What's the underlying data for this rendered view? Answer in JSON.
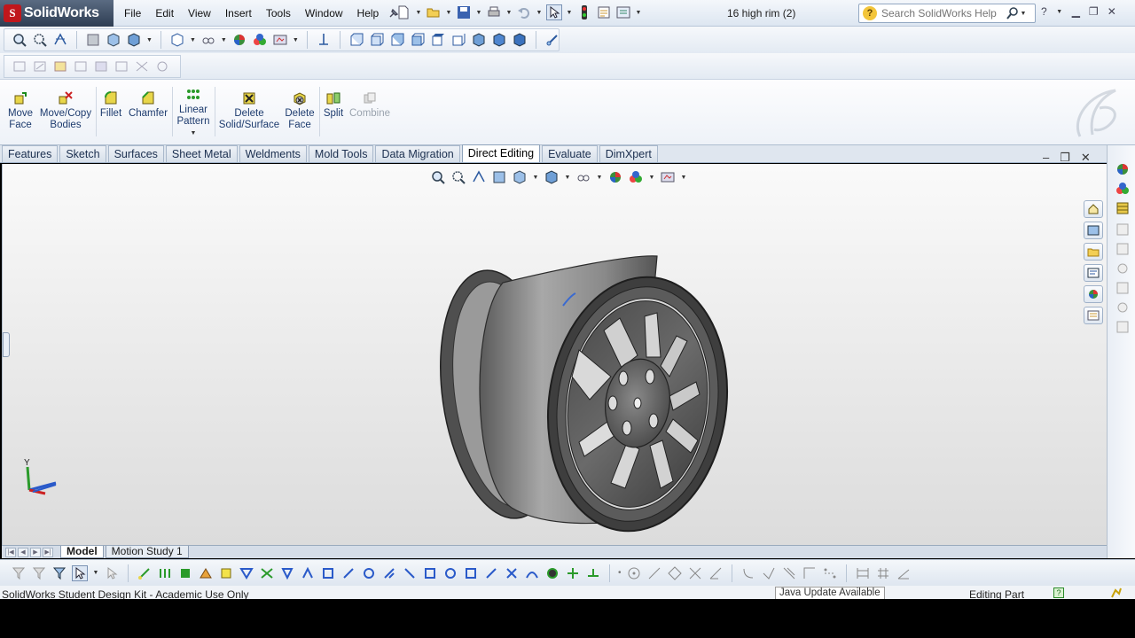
{
  "app": {
    "logo_text": "SolidWorks",
    "menus": [
      "File",
      "Edit",
      "View",
      "Insert",
      "Tools",
      "Window",
      "Help"
    ],
    "document_title": "16 high rim (2)"
  },
  "search": {
    "placeholder": "Search SolidWorks Help"
  },
  "command_manager": {
    "commands": [
      {
        "label": "Move\nFace",
        "icon": "move-face-icon"
      },
      {
        "label": "Move/Copy\nBodies",
        "icon": "move-copy-bodies-icon"
      },
      {
        "label": "Fillet",
        "icon": "fillet-icon"
      },
      {
        "label": "Chamfer",
        "icon": "chamfer-icon"
      },
      {
        "label": "Linear\nPattern",
        "icon": "linear-pattern-icon"
      },
      {
        "label": "Delete\nSolid/Surface",
        "icon": "delete-solid-icon"
      },
      {
        "label": "Delete\nFace",
        "icon": "delete-face-icon"
      },
      {
        "label": "Split",
        "icon": "split-icon"
      },
      {
        "label": "Combine",
        "icon": "combine-icon"
      }
    ]
  },
  "tabs": [
    {
      "label": "Features",
      "active": false
    },
    {
      "label": "Sketch",
      "active": false
    },
    {
      "label": "Surfaces",
      "active": false
    },
    {
      "label": "Sheet Metal",
      "active": false
    },
    {
      "label": "Weldments",
      "active": false
    },
    {
      "label": "Mold Tools",
      "active": false
    },
    {
      "label": "Data Migration",
      "active": false
    },
    {
      "label": "Direct Editing",
      "active": true
    },
    {
      "label": "Evaluate",
      "active": false
    },
    {
      "label": "DimXpert",
      "active": false
    }
  ],
  "model_tabs": [
    {
      "label": "Model",
      "active": true
    },
    {
      "label": "Motion Study 1",
      "active": false
    }
  ],
  "triad": {
    "y_label": "Y"
  },
  "status": {
    "left": "SolidWorks Student Design Kit - Academic Use Only",
    "tooltip": "Java Update Available",
    "mode": "Editing Part",
    "help_glyph": "?"
  },
  "colors": {
    "accent": "#1d3b6e",
    "logo_red": "#c0171c",
    "viewport_top": "#fafafa",
    "viewport_bottom": "#dcdcdc"
  }
}
